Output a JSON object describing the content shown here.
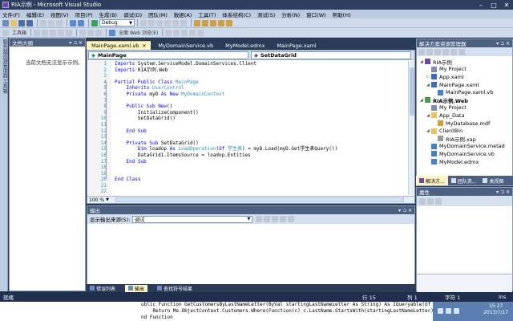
{
  "window": {
    "title": "RIA示例 - Microsoft Visual Studio",
    "controls": [
      "–",
      "□",
      "✕"
    ]
  },
  "menu": [
    "文件(F)",
    "编辑(E)",
    "视图(V)",
    "项目(P)",
    "生成(B)",
    "调试(D)",
    "团队(M)",
    "数据(A)",
    "工具(T)",
    "体系结构(C)",
    "测试(S)",
    "分析(N)",
    "窗口(W)",
    "帮助(H)"
  ],
  "toolbar": {
    "config": "Debug",
    "toolbox_label": "工具箱",
    "search_label": "全面 Web 浏览(E)"
  },
  "doc_outline": {
    "title": "文档大纲",
    "empty_msg": "当前文档无法显示示例。"
  },
  "left_strip": {
    "label": "服务器资源管理器 工具箱"
  },
  "editor": {
    "tabs": [
      {
        "label": "MainPage.xaml.vb",
        "active": true
      },
      {
        "label": "MyDomainService.vb",
        "active": false
      },
      {
        "label": "MyModel.edmx",
        "active": false
      },
      {
        "label": "MainPage.xaml",
        "active": false
      }
    ],
    "nav_left": "MainPage",
    "nav_right": "SetDataGrid",
    "lines": [
      "1",
      "2",
      "3",
      "4",
      "5",
      "6",
      "7",
      "8",
      "9",
      "10",
      "11",
      "12",
      "13",
      "14",
      "15",
      "16",
      "17",
      "18",
      "19",
      "20",
      "21",
      "22"
    ],
    "zoom": "100 %"
  },
  "output": {
    "title": "输出",
    "source_label": "显示输出来源(S):",
    "source_value": "调试"
  },
  "bottom_tabs": [
    {
      "label": "错误列表",
      "active": false
    },
    {
      "label": "输出",
      "active": true
    },
    {
      "label": "查找符号结果",
      "active": false
    }
  ],
  "solution": {
    "title": "解决方案资源管理器",
    "items": [
      {
        "label": "RIA示例",
        "indent": 1,
        "bold": false,
        "exp": "◢",
        "color": "#6c4aa5"
      },
      {
        "label": "My Project",
        "indent": 2,
        "bold": false,
        "exp": "",
        "color": "#7f8fa8"
      },
      {
        "label": "App.xaml",
        "indent": 2,
        "bold": false,
        "exp": "▷",
        "color": "#3b6db8"
      },
      {
        "label": "MainPage.xaml",
        "indent": 2,
        "bold": false,
        "exp": "◢",
        "color": "#3b6db8"
      },
      {
        "label": "MainPage.xaml.vb",
        "indent": 3,
        "bold": false,
        "exp": "",
        "color": "#4a7fc6"
      },
      {
        "label": "RIA示例.Web",
        "indent": 1,
        "bold": true,
        "exp": "◢",
        "color": "#4a9a4a"
      },
      {
        "label": "My Project",
        "indent": 2,
        "bold": false,
        "exp": "",
        "color": "#7f8fa8"
      },
      {
        "label": "App_Data",
        "indent": 2,
        "bold": false,
        "exp": "◢",
        "color": "#e8c45a"
      },
      {
        "label": "MyDatabase.mdf",
        "indent": 3,
        "bold": false,
        "exp": "",
        "color": "#c9a23a"
      },
      {
        "label": "ClientBin",
        "indent": 2,
        "bold": false,
        "exp": "◢",
        "color": "#e8c45a"
      },
      {
        "label": "RIA示例.xap",
        "indent": 3,
        "bold": false,
        "exp": "",
        "color": "#9a9a9a"
      },
      {
        "label": "MyDomainService.metad",
        "indent": 2,
        "bold": false,
        "exp": "",
        "color": "#4a7fc6"
      },
      {
        "label": "MyDomainService.vb",
        "indent": 2,
        "bold": false,
        "exp": "",
        "color": "#4a7fc6"
      },
      {
        "label": "MyModel.edmx",
        "indent": 2,
        "bold": false,
        "exp": "",
        "color": "#4a7fc6"
      }
    ],
    "tabs": [
      {
        "label": "解决方...",
        "active": true
      },
      {
        "label": "团队资...",
        "active": false
      },
      {
        "label": "类视图",
        "active": false
      }
    ]
  },
  "properties": {
    "title": "属性"
  },
  "status": {
    "text": "就绪",
    "line": "行 15",
    "col": "列 1",
    "ch": "字符 1",
    "mode": "Ins"
  },
  "background_code": [
    "ublic Function GetCustomersByLastNameLetter(ByVal startingLastNameLetter As String) As IQueryable(Of Custo",
    "    Return Me.ObjectContext.Customers.Where(Function(c) c.LastName.StartsWith(startingLastNameLetter) = Tru",
    "nd Function"
  ],
  "tray": {
    "time": "15:27",
    "date": "2013/7/17"
  }
}
